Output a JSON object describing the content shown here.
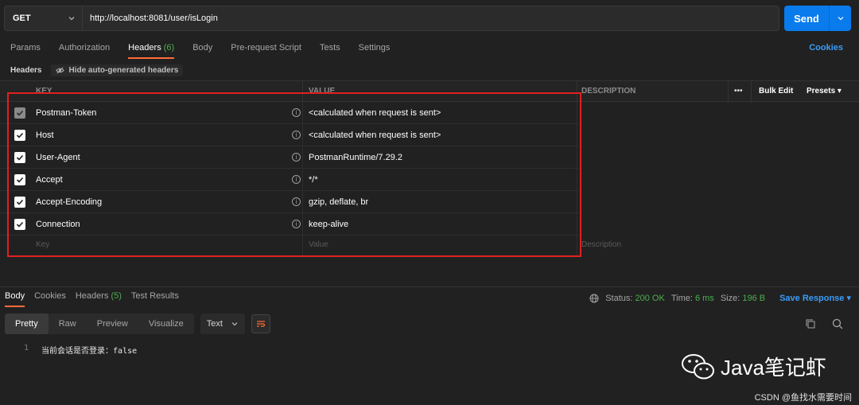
{
  "request": {
    "method": "GET",
    "url": "http://localhost:8081/user/isLogin",
    "send_label": "Send"
  },
  "tabs": [
    {
      "label": "Params"
    },
    {
      "label": "Authorization"
    },
    {
      "label": "Headers",
      "count": "(6)"
    },
    {
      "label": "Body"
    },
    {
      "label": "Pre-request Script"
    },
    {
      "label": "Tests"
    },
    {
      "label": "Settings"
    }
  ],
  "cookies_link": "Cookies",
  "subbar": {
    "title": "Headers",
    "hide_auto": "Hide auto-generated headers"
  },
  "table": {
    "columns": {
      "key": "KEY",
      "value": "VALUE",
      "description": "DESCRIPTION"
    },
    "bulk_edit": "Bulk Edit",
    "presets": "Presets",
    "rows": [
      {
        "key": "Postman-Token",
        "value": "<calculated when request is sent>"
      },
      {
        "key": "Host",
        "value": "<calculated when request is sent>"
      },
      {
        "key": "User-Agent",
        "value": "PostmanRuntime/7.29.2"
      },
      {
        "key": "Accept",
        "value": "*/*"
      },
      {
        "key": "Accept-Encoding",
        "value": "gzip, deflate, br"
      },
      {
        "key": "Connection",
        "value": "keep-alive"
      }
    ],
    "placeholders": {
      "key": "Key",
      "value": "Value",
      "description": "Description"
    }
  },
  "response": {
    "tabs": [
      {
        "label": "Body"
      },
      {
        "label": "Cookies"
      },
      {
        "label": "Headers",
        "count": "(5)"
      },
      {
        "label": "Test Results"
      }
    ],
    "status_label": "Status:",
    "status_value": "200 OK",
    "time_label": "Time:",
    "time_value": "6 ms",
    "size_label": "Size:",
    "size_value": "196 B",
    "save_response": "Save Response",
    "views": [
      "Pretty",
      "Raw",
      "Preview",
      "Visualize"
    ],
    "format": "Text",
    "code_line_number": "1",
    "code_text": "当前会话是否登录：false"
  },
  "watermark": "Java笔记虾",
  "csdn": "CSDN @鱼找水需要时间",
  "colors": {
    "accent": "#ff6c37",
    "send": "#097bed",
    "ok": "#4cae4f",
    "link": "#3b9cf7",
    "highlight": "#e02020"
  }
}
